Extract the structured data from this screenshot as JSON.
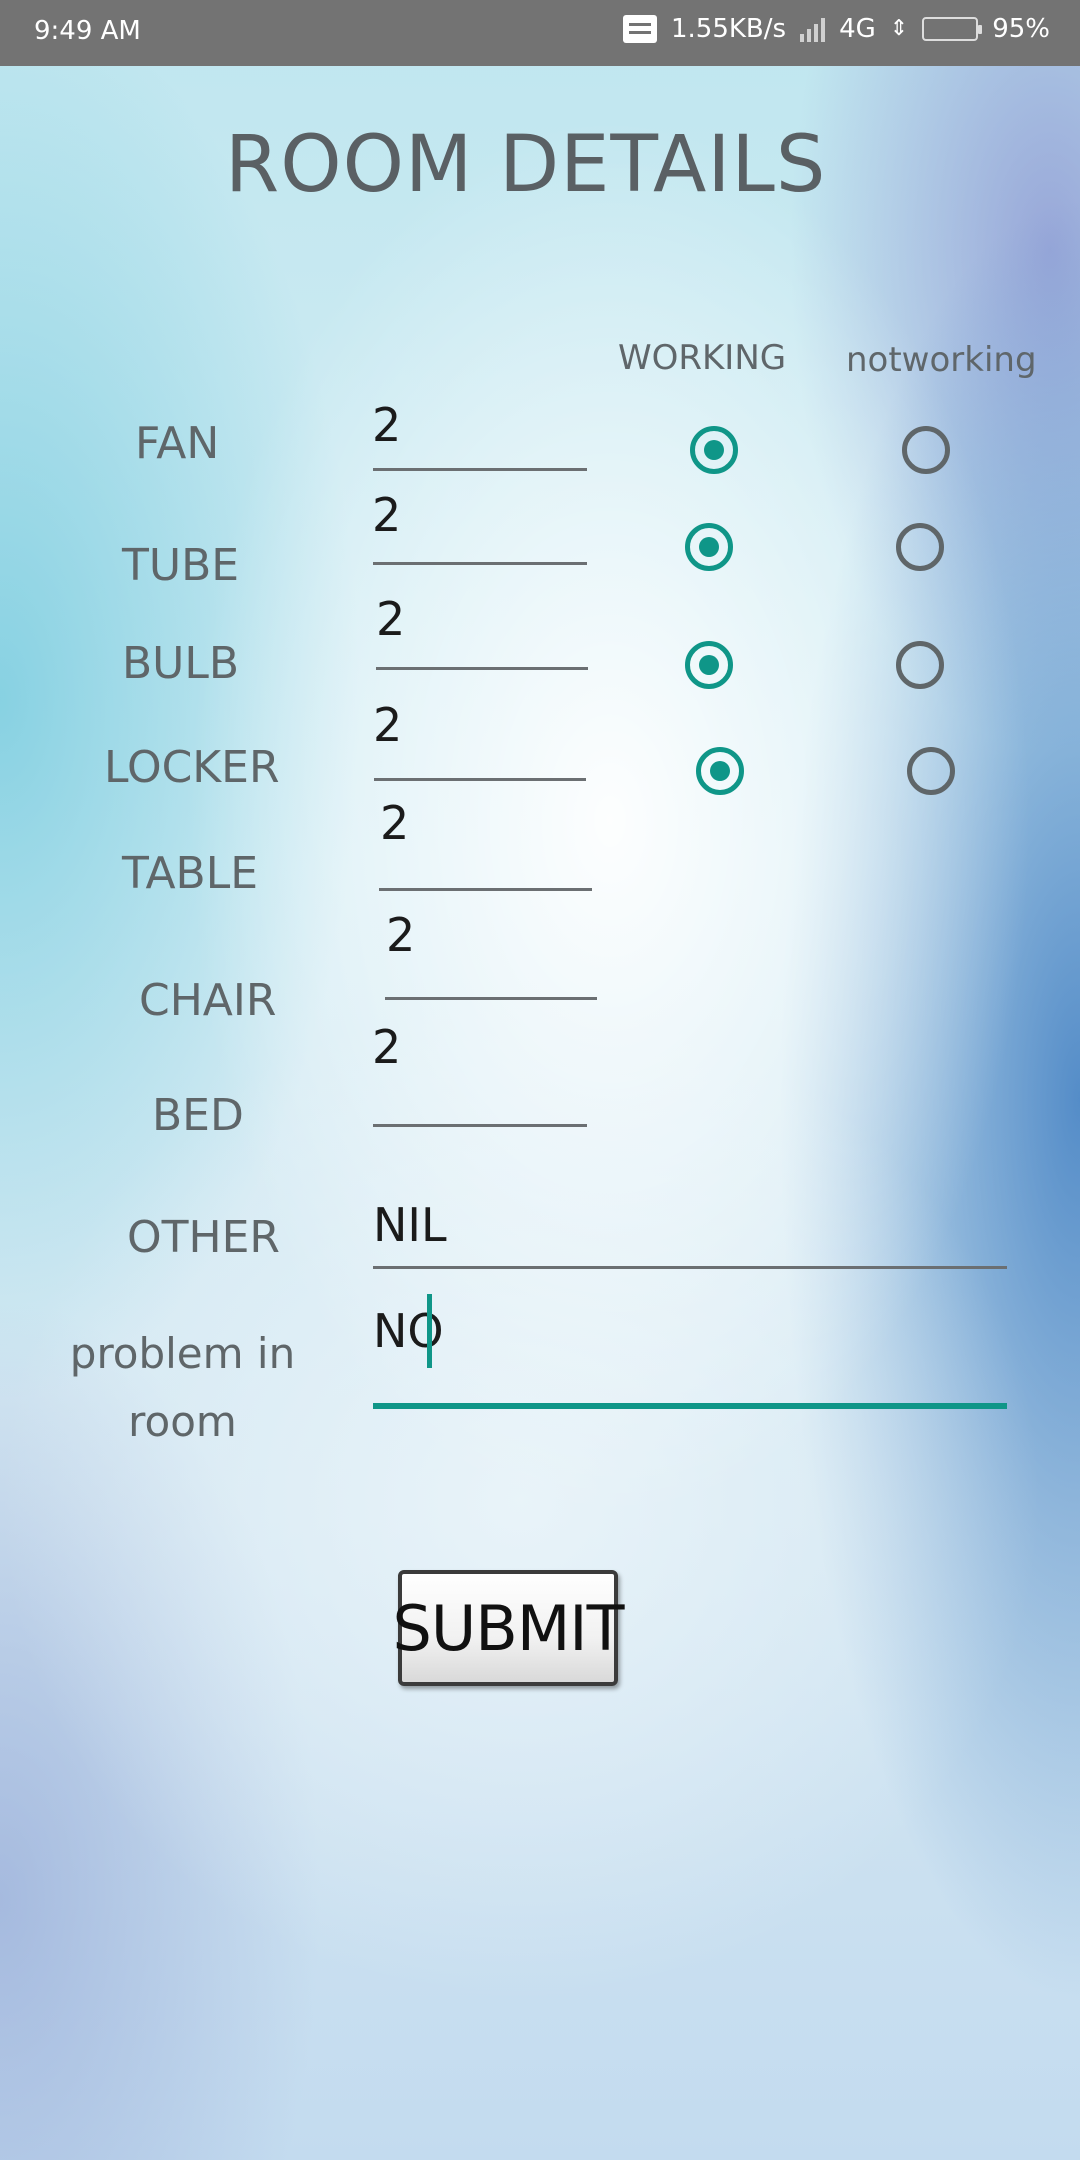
{
  "status_bar": {
    "time": "9:49 AM",
    "speed": "1.55KB/s",
    "network": "4G",
    "battery": "95%",
    "battery_level": 0.95
  },
  "page_title": "ROOM DETAILS",
  "columns": {
    "working": "WORKING",
    "notworking": "notworking"
  },
  "rows": [
    {
      "label": "FAN",
      "value": "2",
      "status": "working"
    },
    {
      "label": "TUBE",
      "value": "2",
      "status": "working"
    },
    {
      "label": "BULB",
      "value": "2",
      "status": "working"
    },
    {
      "label": "LOCKER",
      "value": "2",
      "status": "working"
    },
    {
      "label": "TABLE",
      "value": "2"
    },
    {
      "label": "CHAIR",
      "value": "2"
    },
    {
      "label": "BED",
      "value": "2"
    }
  ],
  "other": {
    "label": "OTHER",
    "value": "NIL"
  },
  "problem": {
    "label": "problem in room",
    "value": "NO"
  },
  "submit_label": "SUBMIT",
  "colors": {
    "accent": "#0f9688",
    "status_bar": "#737373",
    "label_text": "#5f6669"
  }
}
